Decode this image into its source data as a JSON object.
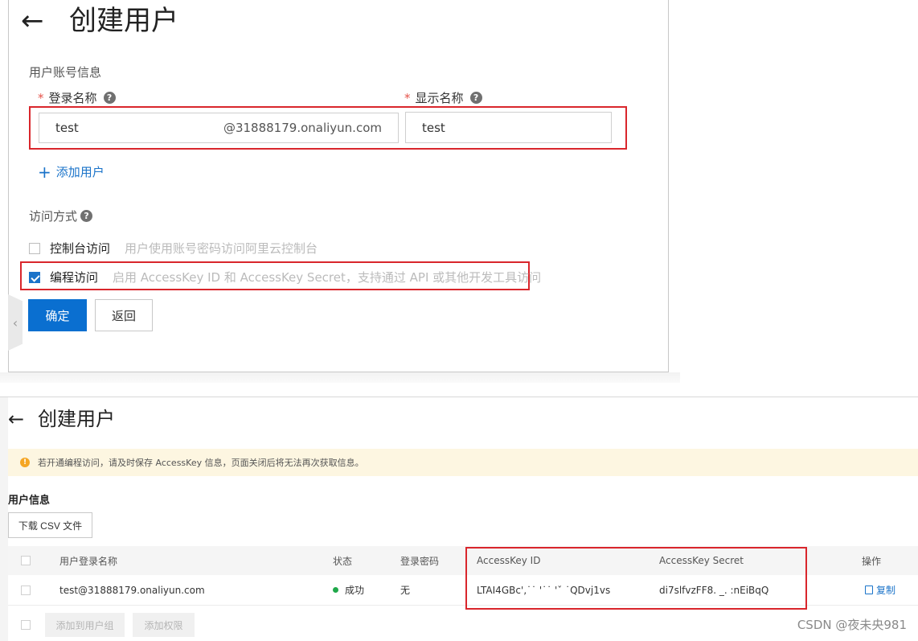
{
  "panel1": {
    "back_icon": "←",
    "title": "创建用户",
    "section_title": "用户账号信息",
    "login_name": {
      "required_mark": "*",
      "label": "登录名称",
      "help_icon": "?",
      "value": "test",
      "suffix": "@31888179.onaliyun.com"
    },
    "display_name": {
      "required_mark": "*",
      "label": "显示名称",
      "help_icon": "?",
      "value": "test"
    },
    "add_user": {
      "icon": "+",
      "label": "添加用户"
    },
    "access_method": {
      "label": "访问方式",
      "help_icon": "?"
    },
    "console_access": {
      "checked": false,
      "label": "控制台访问",
      "description": "用户使用账号密码访问阿里云控制台"
    },
    "programmatic_access": {
      "checked": true,
      "label": "编程访问",
      "description": "启用 AccessKey ID 和 AccessKey Secret，支持通过 API 或其他开发工具访问"
    },
    "confirm_button": "确定",
    "back_button": "返回",
    "collapse_icon": "‹",
    "highlight_color": "#d9262c",
    "primary_color": "#0a6fd0"
  },
  "panel2": {
    "back_icon": "←",
    "title": "创建用户",
    "notice_icon": "!",
    "notice": "若开通编程访问，请及时保存 AccessKey 信息，页面关闭后将无法再次获取信息。",
    "user_info_title": "用户信息",
    "download_button": "下载 CSV 文件",
    "table": {
      "columns": [
        "用户登录名称",
        "状态",
        "登录密码",
        "AccessKey ID",
        "AccessKey Secret",
        "操作"
      ],
      "rows": [
        {
          "login_name": "test@31888179.onaliyun.com",
          "status": "成功",
          "password": "无",
          "access_key_id": "LTAI4GBc'‚˙˙ '˙˙ 'ˇ ˙QDvj1vs",
          "access_key_secret": "di7slfvzFF8. _.              :nEiBqQ",
          "action": "复制"
        }
      ]
    },
    "add_to_group_button": "添加到用户组",
    "add_permission_button": "添加权限",
    "watermark": "CSDN @夜未央981",
    "status_color": "#1fa84a",
    "notice_bg": "#fdf6e1"
  }
}
